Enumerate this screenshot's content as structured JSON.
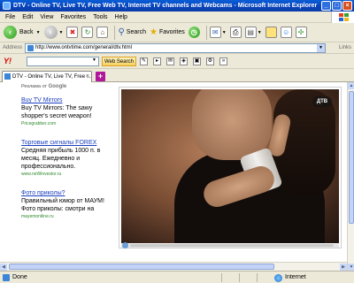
{
  "window": {
    "title": "DTV - Online TV, Live TV, Free Web TV, Internet TV channels and Webcams - Microsoft Internet Explorer"
  },
  "menu": {
    "items": [
      "File",
      "Edit",
      "View",
      "Favorites",
      "Tools",
      "Help"
    ]
  },
  "toolbar": {
    "back_label": "Back",
    "search_label": "Search",
    "favorites_label": "Favorites"
  },
  "address": {
    "label": "Address",
    "url": "http://www.ontvtime.com/general/dtv.html",
    "links_label": "Links"
  },
  "yahoo": {
    "logo": "Y!",
    "search_button": "Web Search"
  },
  "tab": {
    "title": "DTV - Online TV, Live TV, Free ..."
  },
  "ads": {
    "header_prefix": "Реклама от ",
    "header_brand": "Google",
    "items": [
      {
        "title": "Buy TV Mirrors",
        "body": "Buy TV Mirrors: The sawy shopper's secret weapon!",
        "url": "Pricegrabber.com"
      },
      {
        "title": "Торговые сигналы FOREX",
        "body": "Средняя прибыль 1000 п. в месяц. Ежедневно и профессионально.",
        "url": "www.neWinvestor.ru"
      },
      {
        "title": "Фото приколы?",
        "body": "Правильный юмор от МАУМ! Фото приколы: смотри на",
        "url": "mayemoniline.ru"
      }
    ]
  },
  "player": {
    "channel_logo": "ДТВ"
  },
  "status": {
    "text": "Done",
    "zone": "Internet"
  },
  "colors": {
    "title_blue": "#0a5fd8",
    "link_blue": "#1a3fbf",
    "ad_url_green": "#2d8a2d",
    "newtab_magenta": "#b0179a"
  }
}
